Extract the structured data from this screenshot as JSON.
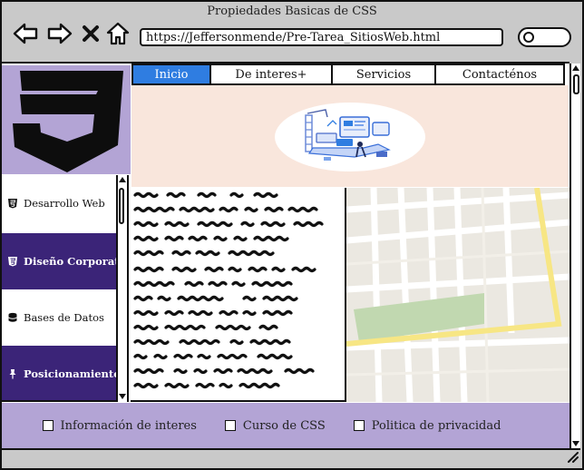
{
  "window": {
    "title": "Propiedades Basicas de CSS"
  },
  "browser": {
    "url": "https://Jeffersonmende/Pre-Tarea_SitiosWeb.html",
    "buttons": [
      "back-icon",
      "forward-icon",
      "close-icon",
      "home-icon"
    ],
    "search_icon": "search-icon"
  },
  "topnav": {
    "tabs": [
      {
        "label": "Inicio",
        "active": true
      },
      {
        "label": "De interes+",
        "active": false
      },
      {
        "label": "Servicios",
        "active": false
      },
      {
        "label": "Contacténos",
        "active": false
      }
    ]
  },
  "sidebar": {
    "items": [
      {
        "label": "Desarrollo Web",
        "icon": "html5-icon",
        "style": "light"
      },
      {
        "label": "Diseño Corporativo",
        "icon": "css3-icon",
        "style": "dark"
      },
      {
        "label": "Bases de Datos",
        "icon": "database-icon",
        "style": "light"
      },
      {
        "label": "Posicionamiento",
        "icon": "pin-icon",
        "style": "dark"
      }
    ]
  },
  "footer": {
    "links": [
      {
        "label": "Información de interes"
      },
      {
        "label": "Curso de CSS"
      },
      {
        "label": "Politica de privacidad"
      }
    ]
  },
  "colors": {
    "accent": "#2f7de1",
    "purple_light": "#b3a4d5",
    "purple_dark": "#3b2478",
    "hero_bg": "#f9e6dc",
    "map_road_yellow": "#f7e684",
    "map_park": "#c1d8b0"
  }
}
